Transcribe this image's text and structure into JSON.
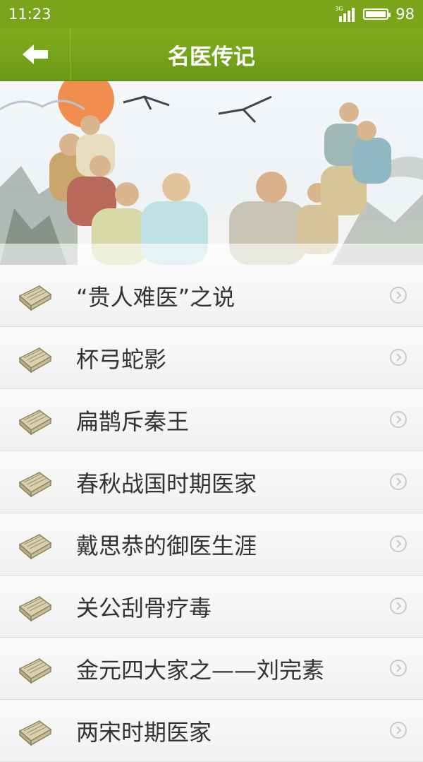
{
  "status": {
    "time": "11:23",
    "network": "3G",
    "battery": "98",
    "battery_level": 0.98
  },
  "header": {
    "title": "名医传记"
  },
  "banner": {
    "image": "ancient-physicians-illustration"
  },
  "icons": {
    "back": "back-arrow-icon",
    "book": "book-icon",
    "chevron": "chevron-right-circle-icon"
  },
  "colors": {
    "accent": "#7aa51a",
    "title_bar": "#6b9915",
    "text": "#333333",
    "divider": "#dcdcdc"
  },
  "items": [
    {
      "label": "“贵人难医”之说"
    },
    {
      "label": "杯弓蛇影"
    },
    {
      "label": "扁鹊斥秦王"
    },
    {
      "label": "春秋战国时期医家"
    },
    {
      "label": "戴思恭的御医生涯"
    },
    {
      "label": "关公刮骨疗毒"
    },
    {
      "label": "金元四大家之——刘完素"
    },
    {
      "label": "两宋时期医家"
    }
  ]
}
